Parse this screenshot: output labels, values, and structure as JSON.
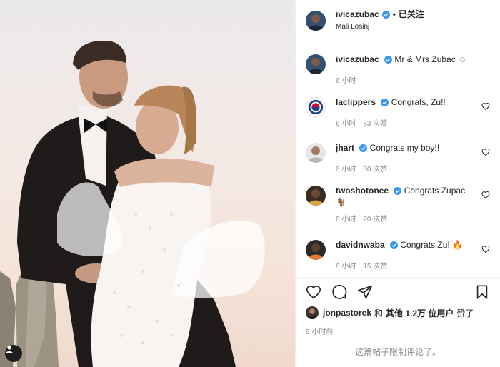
{
  "post": {
    "author": "ivicazubac",
    "follow_state": "已关注",
    "separator": "•",
    "location": "Mali Losinj",
    "caption": "Mr & Mrs Zubac",
    "caption_emoji": "☺",
    "caption_time": "6 小时"
  },
  "comments": [
    {
      "user": "laclippers",
      "text": "Congrats, Zu!!",
      "time": "6 小时",
      "likes": "83 次赞"
    },
    {
      "user": "jhart",
      "text": "Congrats my boy!!",
      "time": "6 小时",
      "likes": "60 次赞"
    },
    {
      "user": "twoshotonee",
      "text": "Congrats Zupac",
      "emoji": "🐐",
      "time": "6 小时",
      "likes": "20 次赞"
    },
    {
      "user": "davidnwaba",
      "text": "Congrats Zu!",
      "emoji": "🔥",
      "time": "6 小时",
      "likes": "15 次赞"
    }
  ],
  "likes_line": {
    "user": "jonpastorek",
    "and": "和",
    "others": "其他 1.2万 位用户",
    "suffix": "赞了"
  },
  "post_time": "6 小时前",
  "comments_closed": "这篇帖子限制评论了。",
  "icons": {
    "verified": "verified-badge-icon",
    "like": "heart-icon",
    "comment": "comment-bubble-icon",
    "share": "paper-plane-icon",
    "save": "bookmark-icon",
    "tag": "user-tag-icon"
  },
  "colors": {
    "verified": "#3897f0",
    "muted": "#8e8e8e",
    "text": "#262626",
    "border": "#efefef"
  }
}
